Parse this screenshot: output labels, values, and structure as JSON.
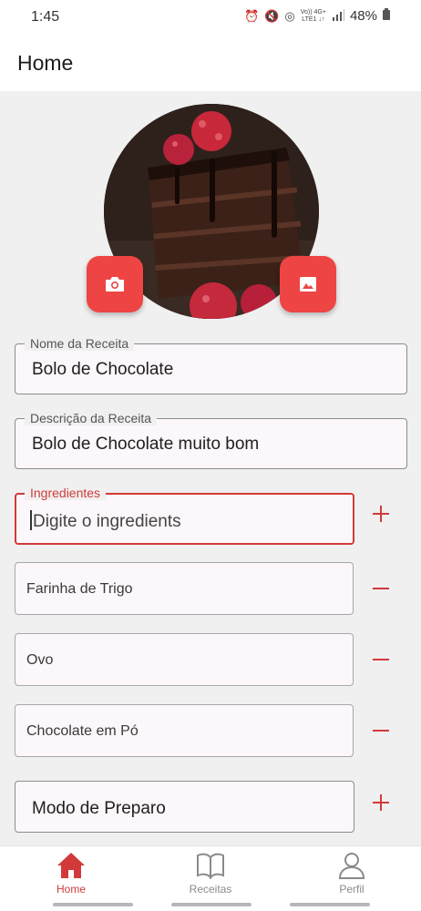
{
  "status": {
    "time": "1:45",
    "battery": "48%",
    "network_top": "Vo)) 4G+",
    "network_bottom": "LTE1 ↓↑"
  },
  "header": {
    "title": "Home"
  },
  "photo_buttons": {
    "camera_icon": "camera-icon",
    "gallery_icon": "image-icon"
  },
  "form": {
    "name": {
      "label": "Nome da Receita",
      "value": "Bolo de Chocolate"
    },
    "description": {
      "label": "Descrição da Receita",
      "value": "Bolo de Chocolate muito bom"
    },
    "ingredients": {
      "label": "Ingredientes",
      "value": "Digite o ingredients"
    },
    "ingredient_items": [
      "Farinha de Trigo",
      "Ovo",
      "Chocolate em Pó"
    ],
    "preparation": {
      "value": "Modo de Preparo"
    }
  },
  "nav": {
    "items": [
      {
        "label": "Home",
        "icon": "home-icon",
        "active": true
      },
      {
        "label": "Receitas",
        "icon": "book-icon",
        "active": false
      },
      {
        "label": "Perfil",
        "icon": "person-icon",
        "active": false
      }
    ]
  },
  "colors": {
    "accent": "#ee4444",
    "accent_dark": "#d23a3a",
    "background": "#f0f0f0"
  }
}
